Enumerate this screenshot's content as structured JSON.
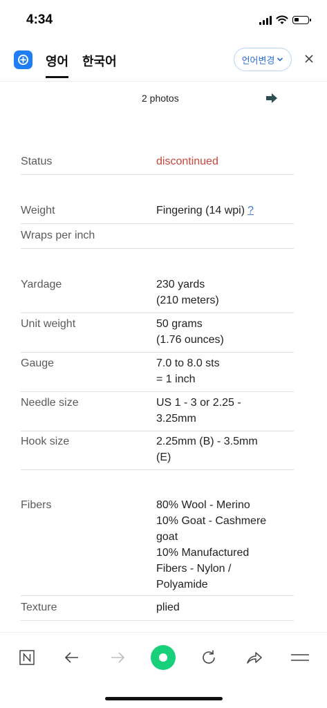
{
  "status_bar": {
    "time": "4:34"
  },
  "translate_bar": {
    "tabs": [
      {
        "label": "영어",
        "active": true
      },
      {
        "label": "한국어",
        "active": false
      }
    ],
    "change_language_label": "언어변경",
    "accent_color": "#1f7ef5"
  },
  "photos": {
    "label": "2 photos"
  },
  "attributes": [
    {
      "label": "Status",
      "value": "discontinued"
    },
    {
      "label": "Weight",
      "value": "Fingering (14 wpi)",
      "help": "?"
    },
    {
      "label": "Wraps per inch",
      "value": ""
    },
    {
      "label": "Yardage",
      "value": "230 yards\n(210 meters)"
    },
    {
      "label": "Unit weight",
      "value": "50 grams\n(1.76 ounces)"
    },
    {
      "label": "Gauge",
      "value": "7.0 to 8.0 sts\n= 1 inch"
    },
    {
      "label": "Needle size",
      "value": "US 1 - 3 or 2.25 -\n3.25mm"
    },
    {
      "label": "Hook size",
      "value": "2.25mm (B) - 3.5mm\n(E)"
    },
    {
      "label": "Fibers",
      "value": "80% Wool - Merino\n10% Goat - Cashmere\ngoat\n10% Manufactured\nFibers - Nylon /\nPolyamide"
    },
    {
      "label": "Texture",
      "value": "plied"
    }
  ],
  "status_color": "#c8463b",
  "toolbar": {
    "icons": [
      "naver-icon",
      "back-arrow-icon",
      "forward-arrow-icon",
      "green-dot-icon",
      "refresh-icon",
      "share-icon",
      "menu-icon"
    ],
    "green_color": "#19d07a"
  }
}
